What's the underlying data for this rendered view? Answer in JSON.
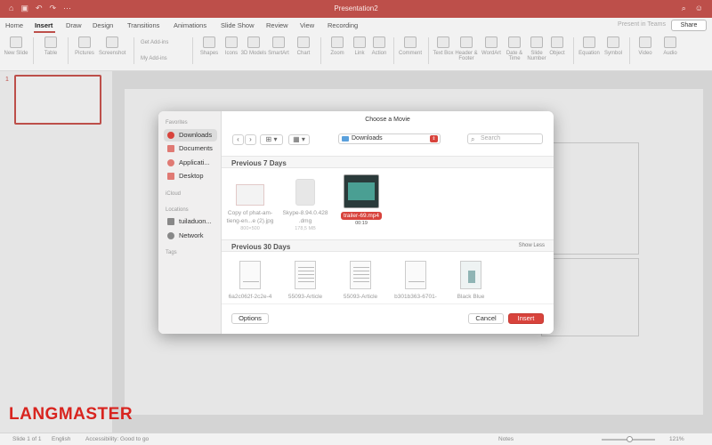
{
  "window": {
    "title": "Presentation2"
  },
  "tabs": [
    "Home",
    "Insert",
    "Draw",
    "Design",
    "Transitions",
    "Animations",
    "Slide Show",
    "Review",
    "View",
    "Recording"
  ],
  "tabs_active": "Insert",
  "present_label": "Present in Teams",
  "share_label": "Share",
  "ribbon": {
    "new_slide": "New Slide",
    "table": "Table",
    "pictures": "Pictures",
    "screenshot": "Screenshot",
    "get_addins": "Get Add-ins",
    "my_addins": "My Add-ins",
    "shapes": "Shapes",
    "icons": "Icons",
    "models_3d": "3D Models",
    "smartart": "SmartArt",
    "chart": "Chart",
    "zoom": "Zoom",
    "link": "Link",
    "action": "Action",
    "comment": "Comment",
    "text_box": "Text Box",
    "header_footer": "Header & Footer",
    "wordart": "WordArt",
    "date_time": "Date & Time",
    "slide_number": "Slide Number",
    "object": "Object",
    "equation": "Equation",
    "symbol": "Symbol",
    "video": "Video",
    "audio": "Audio"
  },
  "thumbnails": {
    "number": "1"
  },
  "dialog": {
    "title": "Choose a Movie",
    "sidebar": {
      "favorites_header": "Favorites",
      "favorites": [
        "Downloads",
        "Documents",
        "Applicati...",
        "Desktop"
      ],
      "icloud_header": "iCloud",
      "locations_header": "Locations",
      "locations": [
        "tuiladuon...",
        "Network"
      ],
      "tags_header": "Tags"
    },
    "location": "Downloads",
    "search_placeholder": "Search",
    "groups": {
      "recent7": "Previous 7 Days",
      "recent30": "Previous 30 Days",
      "show_less": "Show Less"
    },
    "files_7": [
      {
        "name": "Copy of phat-am-tieng-en...e (2).jpg",
        "line1": "Copy of phat-am-",
        "line2": "tieng-en...e (2).jpg",
        "sub": "800×500"
      },
      {
        "name": "Skype-8.94.0.428.dmg",
        "line1": "Skype-8.94.0.428",
        "line2": ".dmg",
        "sub": "178,5 MB"
      },
      {
        "name": "trailer-69.mp4",
        "line1": "trailer-69.mp4",
        "line2": "",
        "sub": "00:19"
      }
    ],
    "files_30": [
      {
        "line1": "6a2c062f-2c2e-4"
      },
      {
        "line1": "55093-Article"
      },
      {
        "line1": "55093-Article"
      },
      {
        "line1": "b301b363-6701-"
      },
      {
        "line1": "Black Blue"
      }
    ],
    "buttons": {
      "options": "Options",
      "cancel": "Cancel",
      "insert": "Insert"
    }
  },
  "status": {
    "slide": "Slide 1 of 1",
    "language": "English",
    "accessibility": "Accessibility: Good to go",
    "notes": "Notes",
    "zoom": "121%"
  },
  "logo": "LANGMASTER",
  "colors": {
    "accent": "#bd4f4a",
    "insert_button": "#d8433c"
  }
}
